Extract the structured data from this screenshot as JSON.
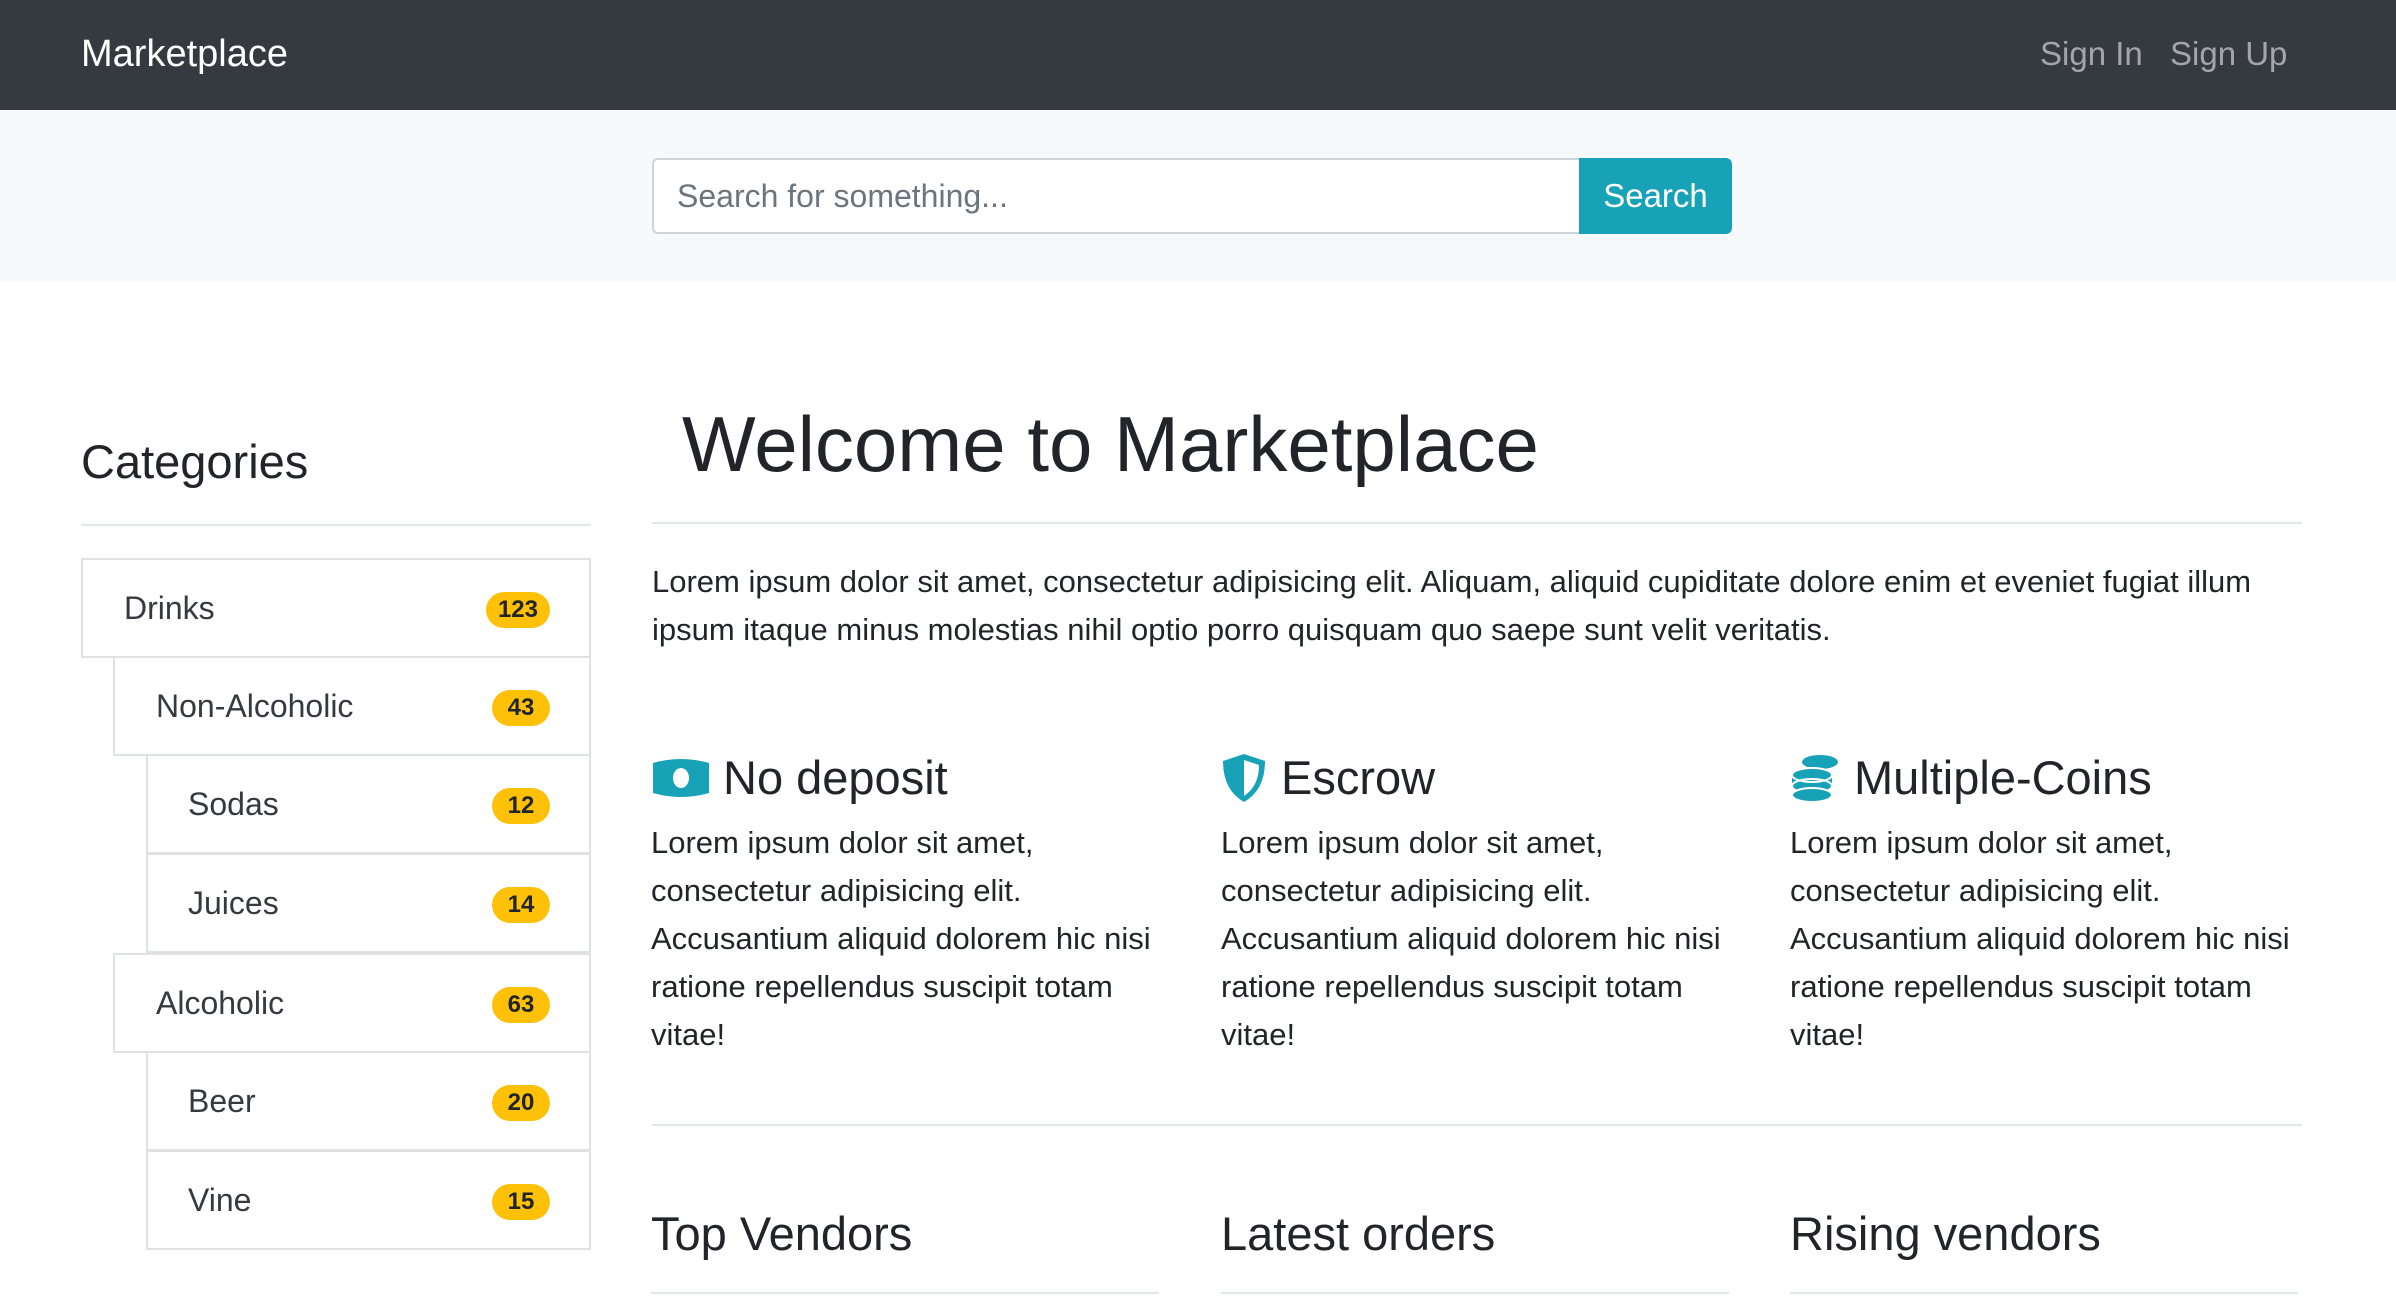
{
  "navbar": {
    "brand": "Marketplace",
    "sign_in": "Sign In",
    "sign_up": "Sign Up"
  },
  "search": {
    "placeholder": "Search for something...",
    "button_label": "Search"
  },
  "sidebar": {
    "title": "Categories",
    "items": [
      {
        "label": "Drinks",
        "count": "123"
      },
      {
        "label": "Non-Alcoholic",
        "count": "43"
      },
      {
        "label": "Sodas",
        "count": "12"
      },
      {
        "label": "Juices",
        "count": "14"
      },
      {
        "label": "Alcoholic",
        "count": "63"
      },
      {
        "label": "Beer",
        "count": "20"
      },
      {
        "label": "Vine",
        "count": "15"
      }
    ]
  },
  "main": {
    "title": "Welcome to Marketplace",
    "intro": "Lorem ipsum dolor sit amet, consectetur adipisicing elit. Aliquam, aliquid cupiditate dolore enim et eveniet fugiat illum ipsum itaque minus molestias nihil optio porro quisquam quo saepe sunt velit veritatis.",
    "features": [
      {
        "icon": "money-bill-icon",
        "title": "No deposit",
        "text": "Lorem ipsum dolor sit amet, consectetur adipisicing elit. Accusantium aliquid dolorem hic nisi ratione repellendus suscipit totam vitae!"
      },
      {
        "icon": "shield-icon",
        "title": "Escrow",
        "text": "Lorem ipsum dolor sit amet, consectetur adipisicing elit. Accusantium aliquid dolorem hic nisi ratione repellendus suscipit totam vitae!"
      },
      {
        "icon": "coins-icon",
        "title": "Multiple-Coins",
        "text": "Lorem ipsum dolor sit amet, consectetur adipisicing elit. Accusantium aliquid dolorem hic nisi ratione repellendus suscipit totam vitae!"
      }
    ],
    "columns": [
      {
        "title": "Top Vendors"
      },
      {
        "title": "Latest orders"
      },
      {
        "title": "Rising vendors"
      }
    ]
  },
  "colors": {
    "navbar_bg": "#343a40",
    "accent": "#17a2b8",
    "badge": "#ffc107"
  }
}
